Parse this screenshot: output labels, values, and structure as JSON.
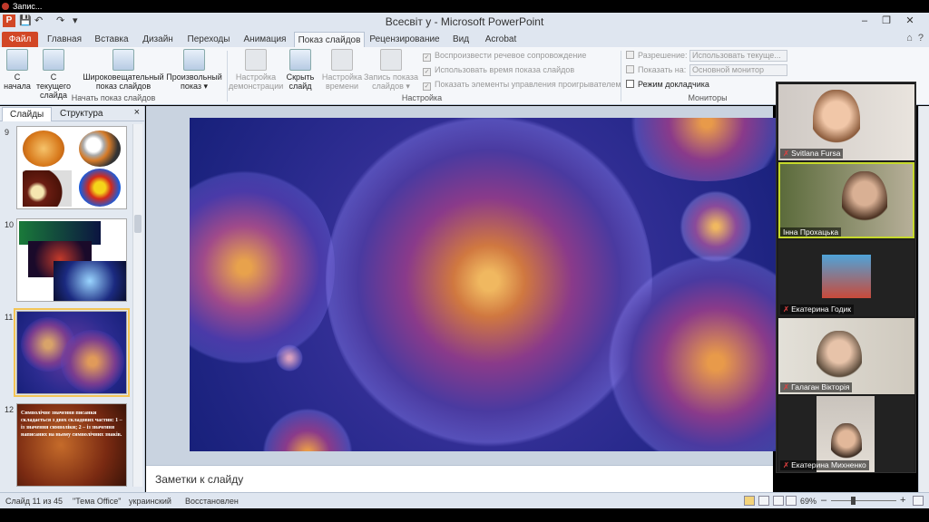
{
  "topbar": {
    "label": "Запис..."
  },
  "window": {
    "title": "Всесвіт у  -  Microsoft PowerPoint",
    "app_icon": "P",
    "controls": {
      "minimize": "–",
      "maximize": "❐",
      "close": "✕"
    }
  },
  "quick_access": {
    "save": "💾",
    "undo": "↶",
    "redo": "↷",
    "customize": "▾"
  },
  "ribbon_tabs": [
    {
      "label": "Файл"
    },
    {
      "label": "Главная"
    },
    {
      "label": "Вставка"
    },
    {
      "label": "Дизайн"
    },
    {
      "label": "Переходы"
    },
    {
      "label": "Анимация"
    },
    {
      "label": "Показ слайдов"
    },
    {
      "label": "Рецензирование"
    },
    {
      "label": "Вид"
    },
    {
      "label": "Acrobat"
    }
  ],
  "ribbon": {
    "start_group": {
      "label": "Начать показ слайдов",
      "from_start": "С начала",
      "from_current": "С текущего слайда",
      "broadcast": "Широковещательный показ слайдов",
      "custom": "Произвольный показ ▾"
    },
    "setup_group": {
      "label": "Настройка",
      "setup_show": "Настройка демонстрации",
      "hide_slide": "Скрыть слайд",
      "rehearse": "Настройка времени",
      "record": "Запись показа слайдов ▾",
      "play_narrations": "Воспроизвести речевое сопровождение",
      "use_timings": "Использовать время показа слайдов",
      "show_media": "Показать элементы управления проигрывателем"
    },
    "monitors_group": {
      "label": "Мониторы",
      "resolution_label": "Разрешение:",
      "resolution_value": "Использовать текуще...",
      "show_on_label": "Показать на:",
      "show_on_value": "Основной монитор",
      "presenter_view": "Режим докладчика"
    }
  },
  "left_panel": {
    "tab_slides": "Слайды",
    "tab_outline": "Структура",
    "close": "×",
    "thumbs": [
      {
        "num": "9"
      },
      {
        "num": "10"
      },
      {
        "num": "11"
      },
      {
        "num": "12",
        "text": "Символічне значення писанки складається з двох складових частин: 1 – із значення символіки; 2 – із значення написаних на ньому символічних знаків."
      }
    ]
  },
  "notes": {
    "placeholder": "Заметки к слайду"
  },
  "participants": [
    {
      "name": "Svitlana Fursa"
    },
    {
      "name": "Інна Прохацька"
    },
    {
      "name": "Екатерина Годик"
    },
    {
      "name": "Галаган Вікторія"
    },
    {
      "name": "Екатерина Михненко"
    }
  ],
  "status": {
    "slide": "Слайд 11 из 45",
    "theme": "\"Тема Office\"",
    "language": "украинский",
    "state": "Восстановлен",
    "zoom": "69%",
    "zoom_out": "–",
    "zoom_in": "+"
  },
  "colors": {
    "file_tab": "#d24726",
    "ribbon_bg": "#f5f7fa",
    "selected_thumb": "#f3c455",
    "active_speaker": "#c6d92b"
  }
}
